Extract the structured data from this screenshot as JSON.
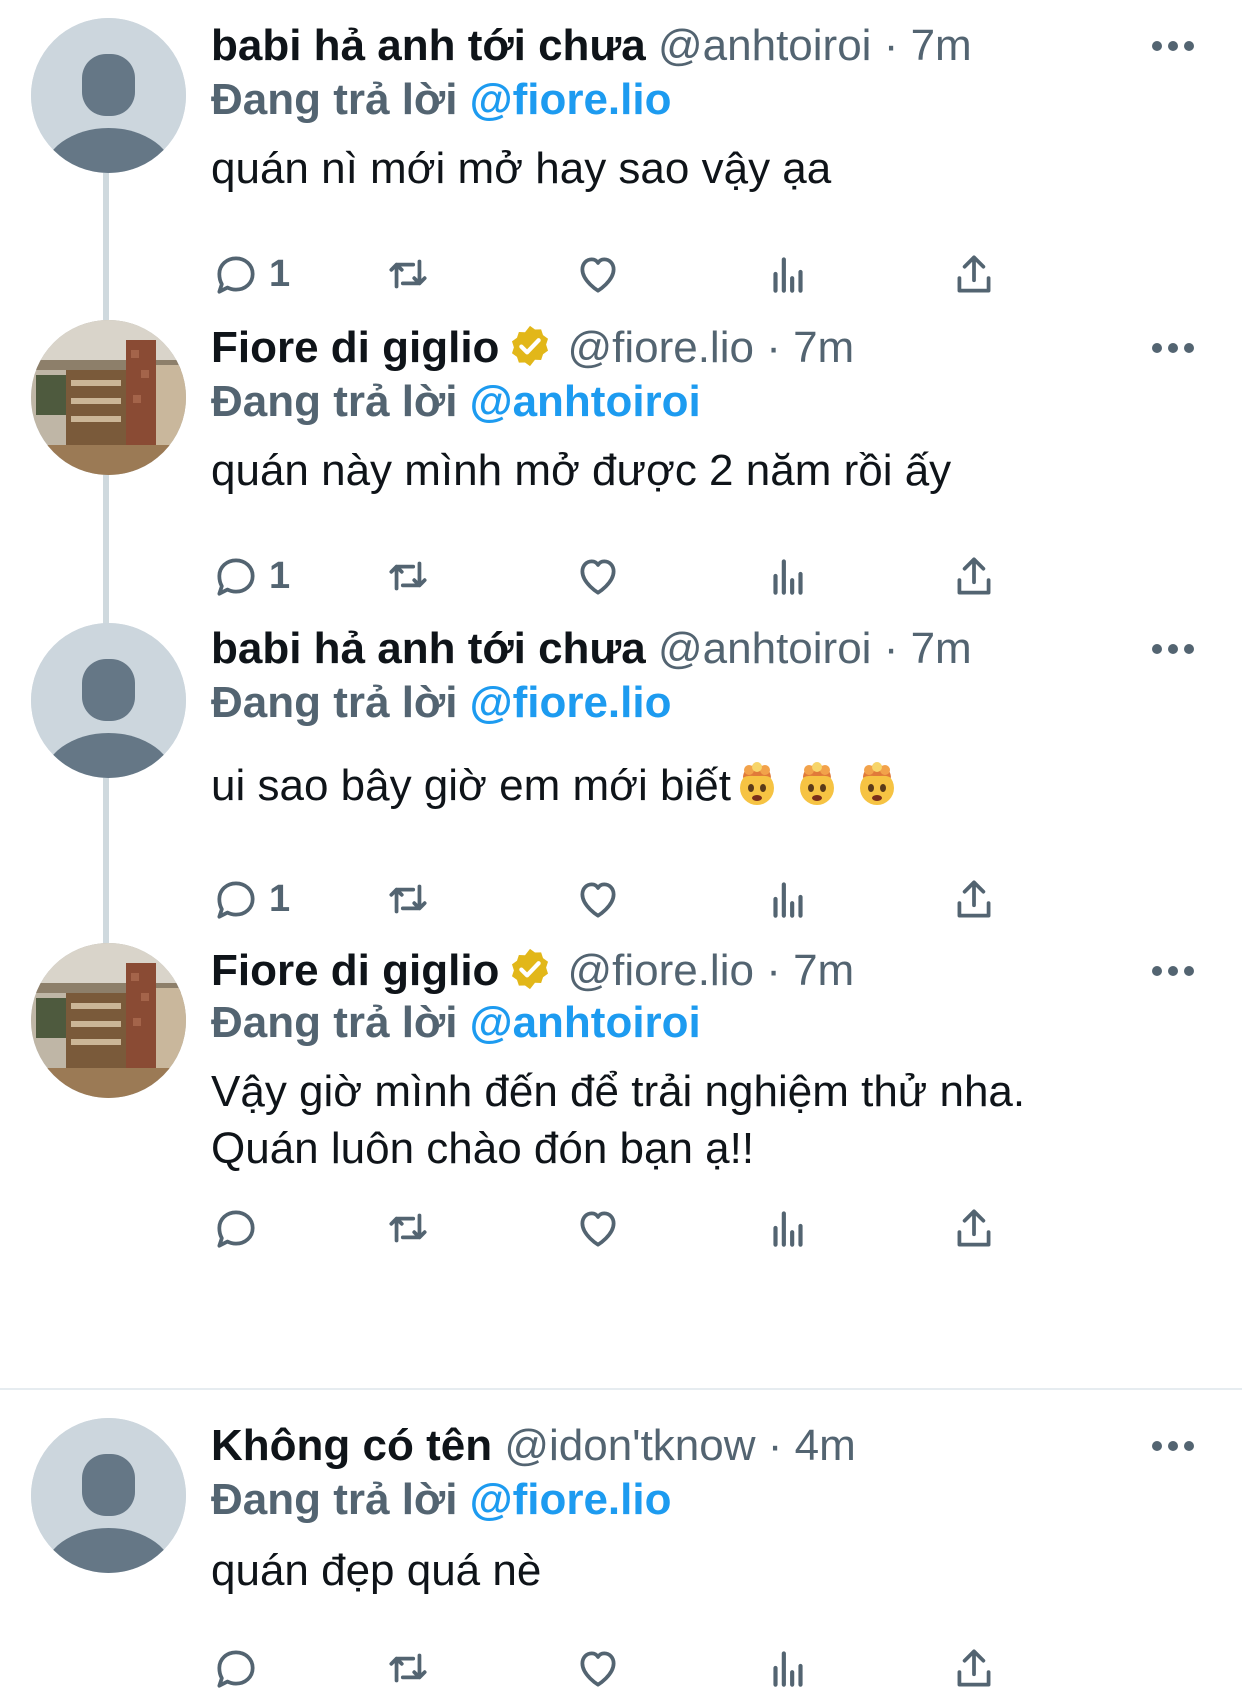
{
  "tweets": [
    {
      "name": "babi hả anh tới chưa",
      "handle": "@anhtoiroi",
      "separator": "·",
      "time": "7m",
      "reply_prefix": "Đang trả lời",
      "reply_mention": "@fiore.lio",
      "text_lines": [
        "quán nì mới mở hay sao vậy ạa"
      ],
      "reply_count": "1",
      "verified": false,
      "avatar": "default-avatar"
    },
    {
      "name": "Fiore di giglio",
      "handle": "@fiore.lio",
      "separator": "·",
      "time": "7m",
      "reply_prefix": "Đang trả lời",
      "reply_mention": "@anhtoiroi",
      "text_lines": [
        "quán này mình mở được 2 năm rồi ấy"
      ],
      "reply_count": "1",
      "verified": true,
      "avatar": "shop-photo-avatar"
    },
    {
      "name": "babi hả anh tới chưa",
      "handle": "@anhtoiroi",
      "separator": "·",
      "time": "7m",
      "reply_prefix": "Đang trả lời",
      "reply_mention": "@fiore.lio",
      "text_lines": [
        "ui sao bây giờ em mới biết"
      ],
      "emojis": [
        "exploding-head-emoji",
        "exploding-head-emoji",
        "exploding-head-emoji"
      ],
      "reply_count": "1",
      "verified": false,
      "avatar": "default-avatar"
    },
    {
      "name": "Fiore di giglio",
      "handle": "@fiore.lio",
      "separator": "·",
      "time": "7m",
      "reply_prefix": "Đang trả lời",
      "reply_mention": "@anhtoiroi",
      "text_lines": [
        "Vậy giờ mình đến để trải nghiệm thử nha.",
        "Quán luôn chào đón bạn ạ!!"
      ],
      "reply_count": "",
      "verified": true,
      "avatar": "shop-photo-avatar"
    },
    {
      "name": "Không có tên",
      "handle": "@idon'tknow",
      "separator": "·",
      "time": "4m",
      "reply_prefix": "Đang trả lời",
      "reply_mention": "@fiore.lio",
      "text_lines": [
        "quán đẹp quá nè"
      ],
      "reply_count": "",
      "verified": false,
      "avatar": "default-avatar"
    }
  ],
  "action_icons": [
    "reply-icon",
    "retweet-icon",
    "like-icon",
    "views-icon",
    "share-icon"
  ],
  "colors": {
    "text": "#0f1419",
    "secondary": "#536471",
    "link": "#1d9bf0",
    "verified_badge": "#e2b719",
    "thread_line": "#cfd9de",
    "default_avatar_bg": "#ccd6dd",
    "default_avatar_fg": "#657786"
  }
}
